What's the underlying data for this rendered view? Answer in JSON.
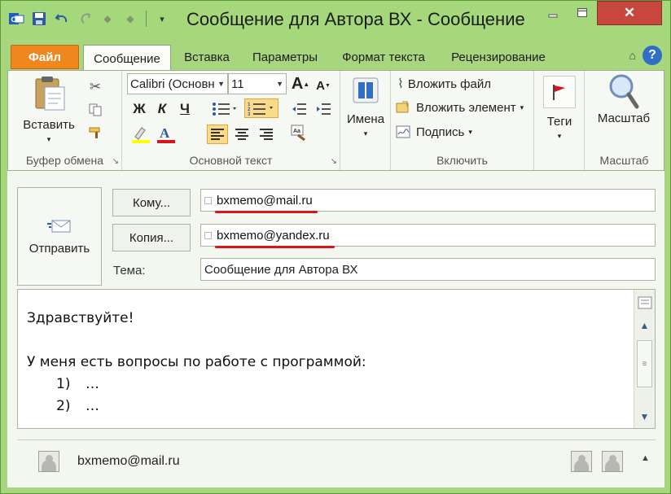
{
  "window": {
    "title": "Сообщение для Автора ВХ  -  Сообщение",
    "min_glyph": "▭",
    "max_glyph": "☐",
    "close_glyph": "✕"
  },
  "tabs": [
    {
      "label": "Файл"
    },
    {
      "label": "Сообщение"
    },
    {
      "label": "Вставка"
    },
    {
      "label": "Параметры"
    },
    {
      "label": "Формат текста"
    },
    {
      "label": "Рецензирование"
    }
  ],
  "ribbon": {
    "clipboard": {
      "label": "Буфер обмена",
      "paste": "Вставить"
    },
    "basic_text": {
      "label": "Основной текст",
      "font_name": "Calibri (Основн",
      "font_size": "11",
      "bold": "Ж",
      "italic": "К",
      "underline": "Ч"
    },
    "names": {
      "button": "Имена"
    },
    "include": {
      "label": "Включить",
      "attach_file": "Вложить файл",
      "attach_item": "Вложить элемент",
      "signature": "Подпись"
    },
    "tags": {
      "button": "Теги"
    },
    "zoom": {
      "label": "Масштаб",
      "button": "Масштаб"
    }
  },
  "compose": {
    "send": "Отправить",
    "to_button": "Кому...",
    "cc_button": "Копия...",
    "to_value": "bxmemo@mail.ru",
    "cc_value": "bxmemo@yandex.ru",
    "subject_label": "Тема:",
    "subject_value": "Сообщение для Автора ВХ"
  },
  "body": {
    "greeting": "Здравствуйте!",
    "intro": "У меня есть вопросы по работе с программой:",
    "items": [
      {
        "num": "1)",
        "text": "…"
      },
      {
        "num": "2)",
        "text": "…"
      }
    ]
  },
  "people_pane": {
    "name": "bxmemo@mail.ru"
  },
  "colors": {
    "accent_green": "#a8d67f",
    "file_tab": "#f0861e",
    "close_red": "#c7463d",
    "underline_red": "#d8141c"
  }
}
